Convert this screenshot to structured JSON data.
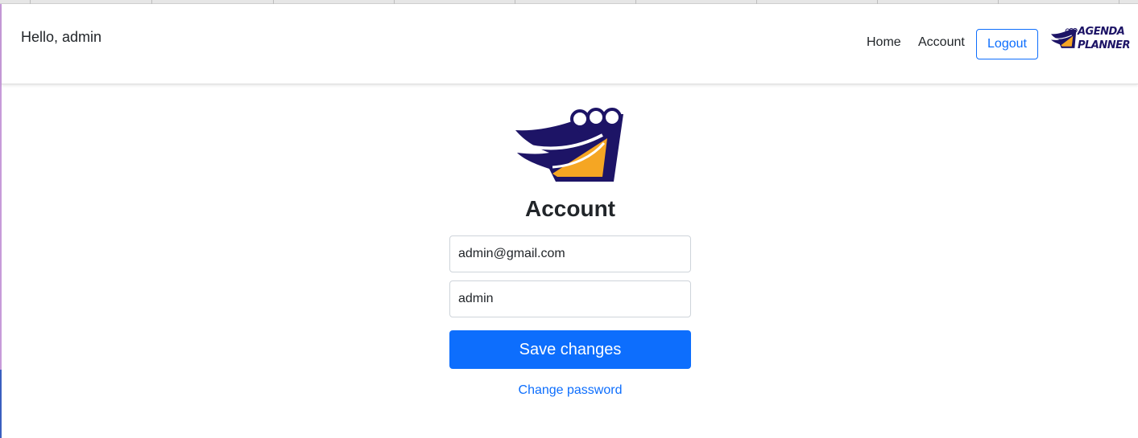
{
  "navbar": {
    "greeting": "Hello, admin",
    "links": {
      "home": "Home",
      "account": "Account"
    },
    "logout_label": "Logout",
    "brand": {
      "line1": "AGENDA",
      "line2": "PLANNER"
    }
  },
  "main": {
    "logo_icon": "agenda-planner-logo",
    "title": "Account",
    "email_value": "admin@gmail.com",
    "username_value": "admin",
    "save_label": "Save changes",
    "change_password_label": "Change password"
  },
  "colors": {
    "primary": "#0d6efd",
    "logo_navy": "#1d1466",
    "logo_orange": "#f5a623"
  }
}
